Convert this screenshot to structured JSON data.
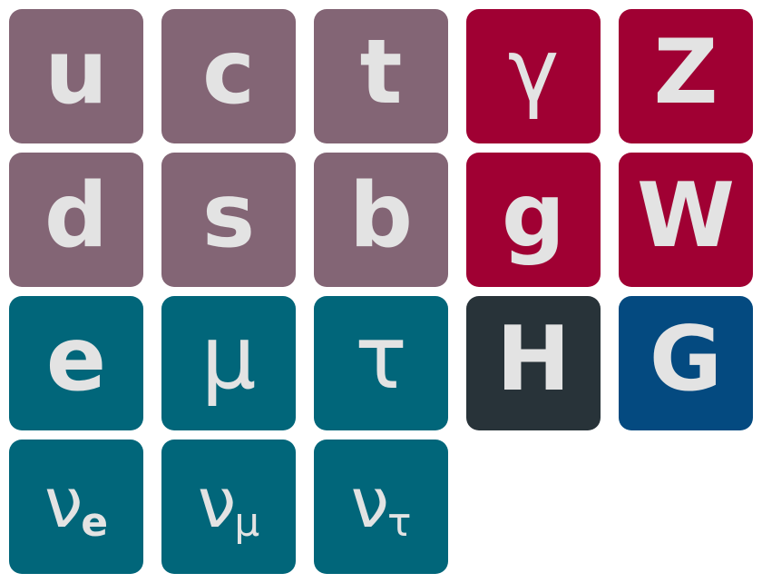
{
  "colors": {
    "quark": "#836575",
    "gauge_boson": "#a00033",
    "lepton": "#01667a",
    "higgs": "#283339",
    "graviton": "#044a80",
    "text": "#e3e3e3",
    "background": "#ffffff"
  },
  "quarks": {
    "up": "u",
    "charm": "c",
    "top": "t",
    "down": "d",
    "strange": "s",
    "bottom": "b"
  },
  "gauge_bosons": {
    "photon": "γ",
    "z": "Z",
    "gluon": "g",
    "w": "W"
  },
  "scalar_bosons": {
    "higgs": "H",
    "graviton": "G"
  },
  "leptons": {
    "electron": "e",
    "muon": "μ",
    "tau": "τ"
  },
  "neutrinos": {
    "electron": {
      "nu": "ν",
      "sub": "e"
    },
    "muon": {
      "nu": "ν",
      "sub": "μ"
    },
    "tau": {
      "nu": "ν",
      "sub": "τ"
    }
  }
}
